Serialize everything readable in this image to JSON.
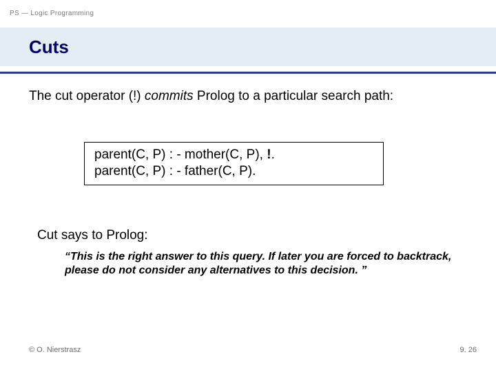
{
  "crumb": "PS — Logic Programming",
  "title": "Cuts",
  "lead_pre": "The cut operator (!) ",
  "lead_commits": "commits",
  "lead_post": " Prolog to a particular search path:",
  "code": {
    "line1_pre": "parent(C, P) : - mother(C, P), ",
    "line1_bang": "!",
    "line1_post": ".",
    "line2": "parent(C, P) : - father(C, P)."
  },
  "says": "Cut says to Prolog:",
  "quote": "“This is the right answer to this query. If later you are forced to backtrack, please do not consider any alternatives to this decision. ”",
  "footer": {
    "left": "© O. Nierstrasz",
    "right": "9. 26"
  }
}
